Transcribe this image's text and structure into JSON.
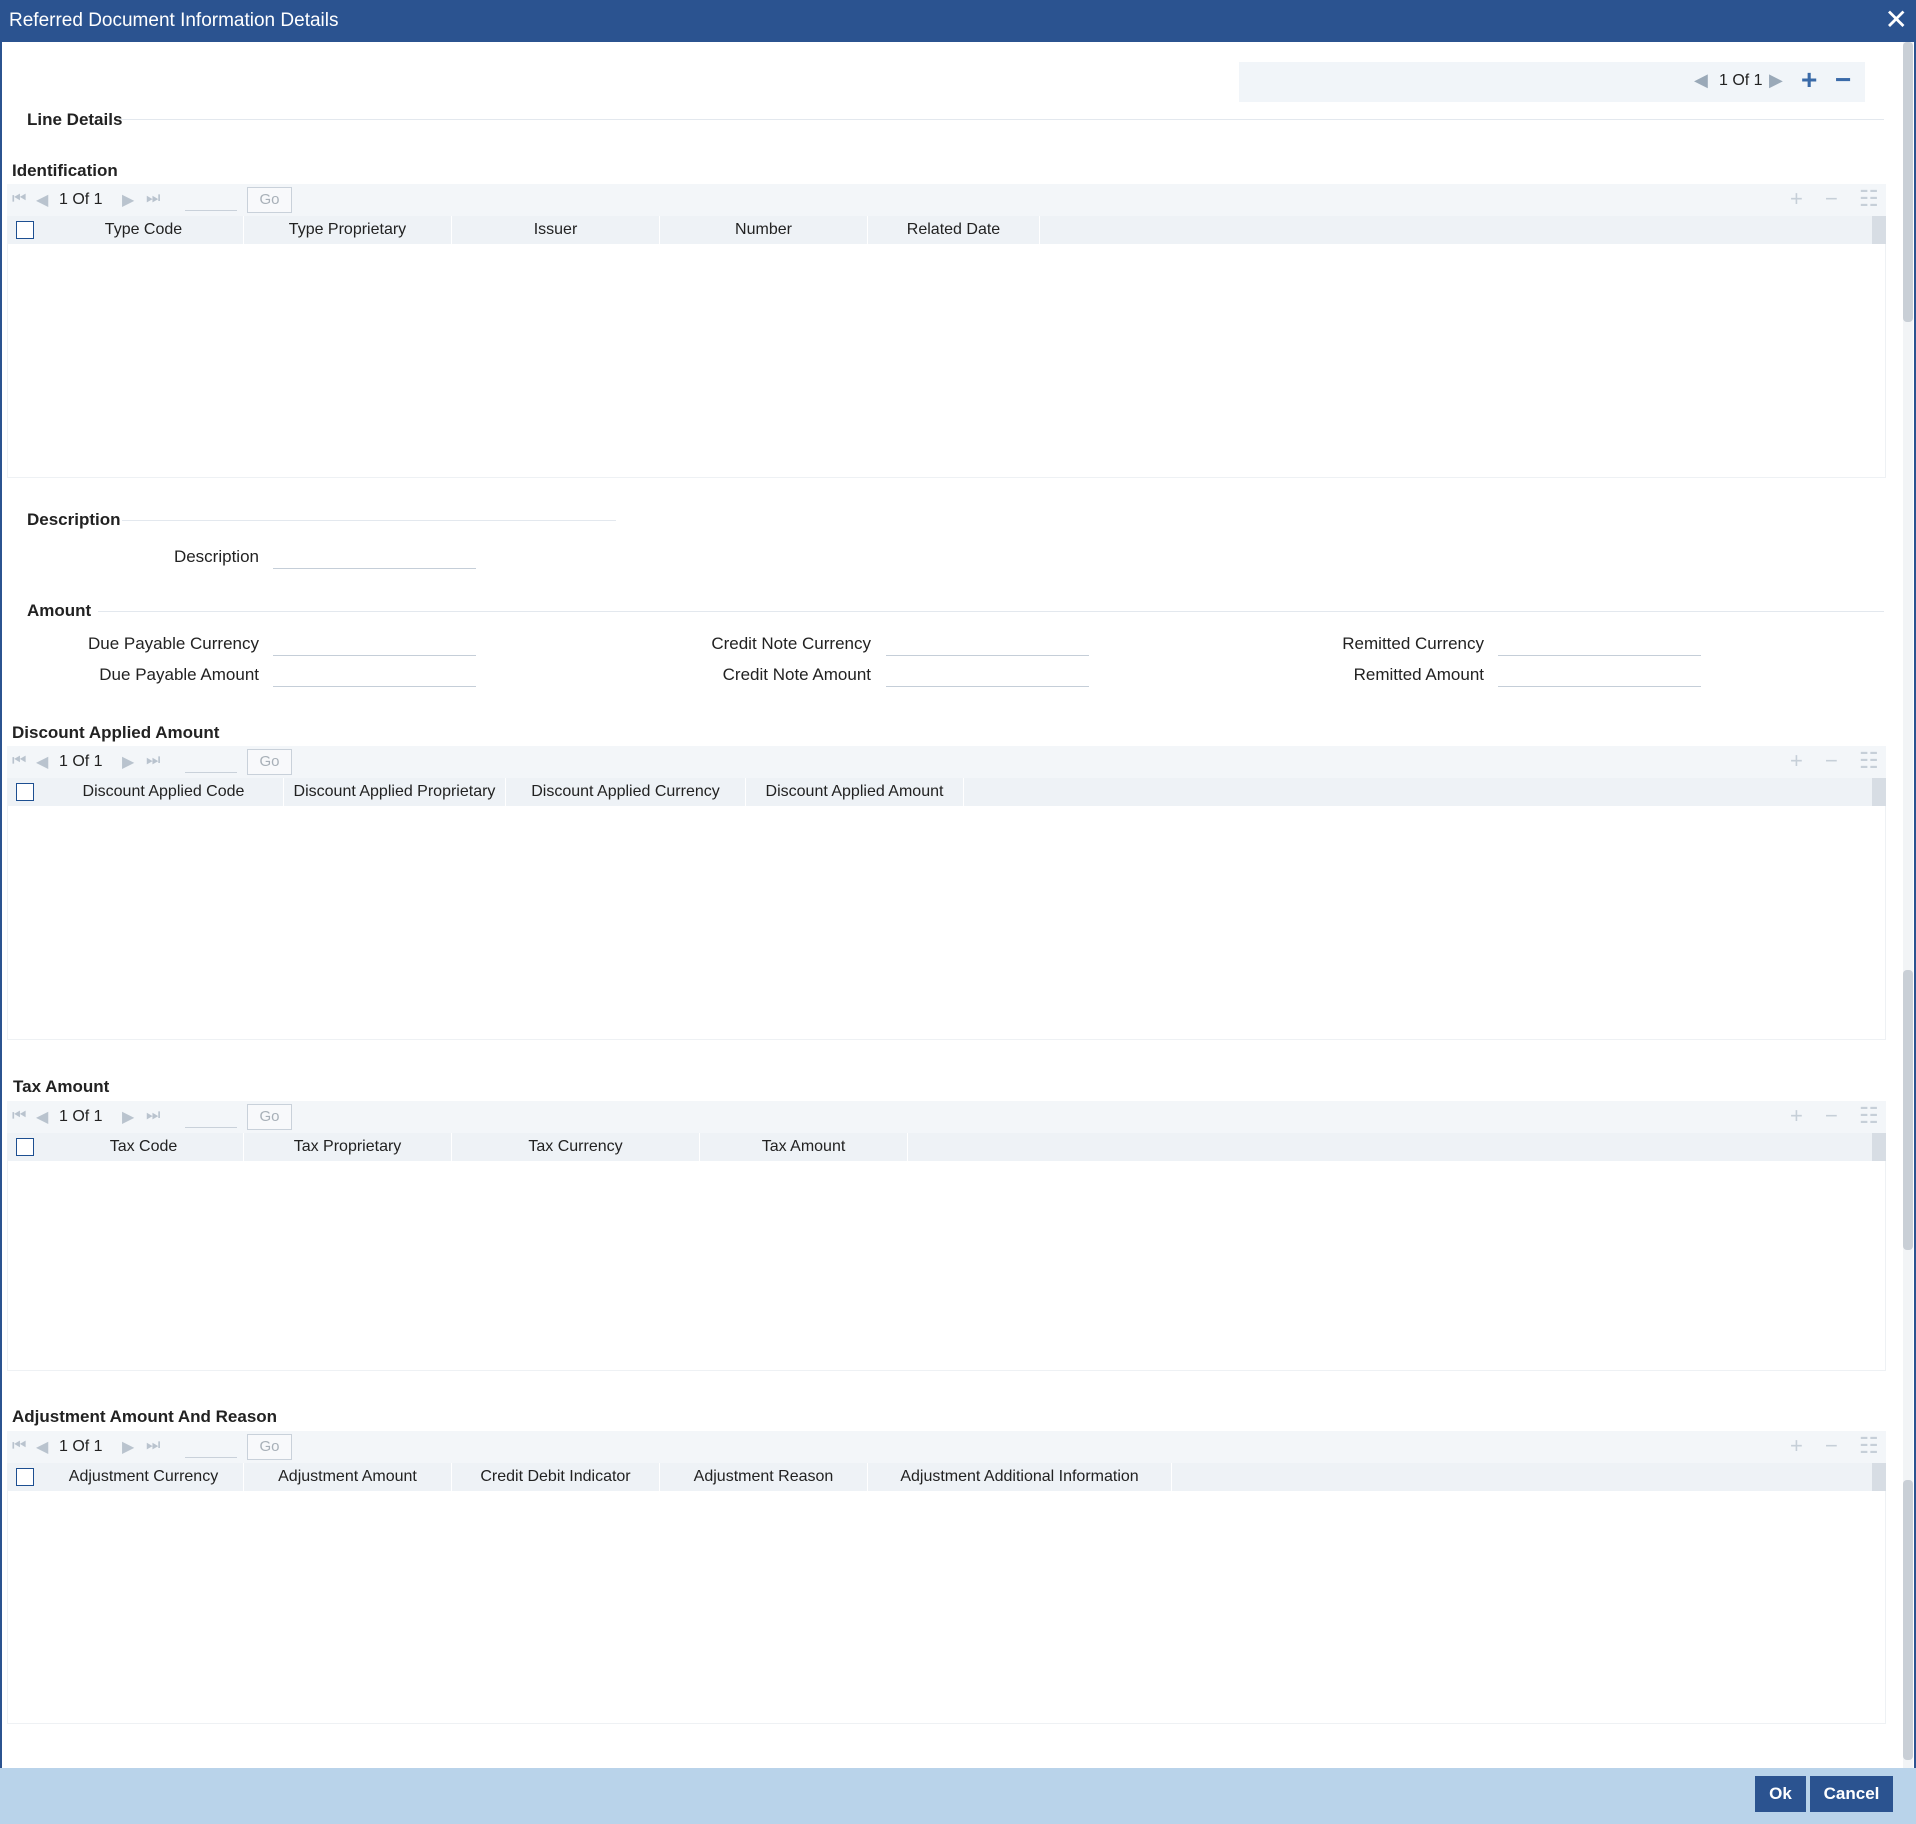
{
  "window": {
    "title": "Referred Document Information Details",
    "close_glyph": "✕"
  },
  "record_nav": {
    "text": "1 Of 1",
    "prev_glyph": "◀",
    "next_glyph": "▶",
    "add_glyph": "+",
    "remove_glyph": "−"
  },
  "line_details": {
    "title": "Line Details"
  },
  "grid_common": {
    "page_text": "1 Of 1",
    "go_label": "Go",
    "first_glyph": "⏮",
    "prev_glyph": "◀",
    "next_glyph": "▶",
    "last_glyph": "⏭",
    "add_glyph": "+",
    "remove_glyph": "−",
    "menu_glyph": "☷"
  },
  "identification": {
    "title": "Identification",
    "columns": [
      "Type Code",
      "Type Proprietary",
      "Issuer",
      "Number",
      "Related Date"
    ]
  },
  "description": {
    "title": "Description",
    "label": "Description",
    "value": ""
  },
  "amount": {
    "title": "Amount",
    "due_payable_currency": {
      "label": "Due Payable Currency",
      "value": ""
    },
    "due_payable_amount": {
      "label": "Due Payable Amount",
      "value": ""
    },
    "credit_note_currency": {
      "label": "Credit Note Currency",
      "value": ""
    },
    "credit_note_amount": {
      "label": "Credit Note Amount",
      "value": ""
    },
    "remitted_currency": {
      "label": "Remitted Currency",
      "value": ""
    },
    "remitted_amount": {
      "label": "Remitted Amount",
      "value": ""
    }
  },
  "discount": {
    "title": "Discount Applied Amount",
    "columns": [
      "Discount Applied Code",
      "Discount Applied Proprietary",
      "Discount Applied Currency",
      "Discount Applied Amount"
    ]
  },
  "tax": {
    "title": "Tax Amount",
    "columns": [
      "Tax Code",
      "Tax Proprietary",
      "Tax Currency",
      "Tax Amount"
    ]
  },
  "adjustment": {
    "title": "Adjustment Amount And Reason",
    "columns": [
      "Adjustment Currency",
      "Adjustment Amount",
      "Credit Debit Indicator",
      "Adjustment Reason",
      "Adjustment Additional Information"
    ]
  },
  "footer": {
    "ok_label": "Ok",
    "cancel_label": "Cancel"
  }
}
